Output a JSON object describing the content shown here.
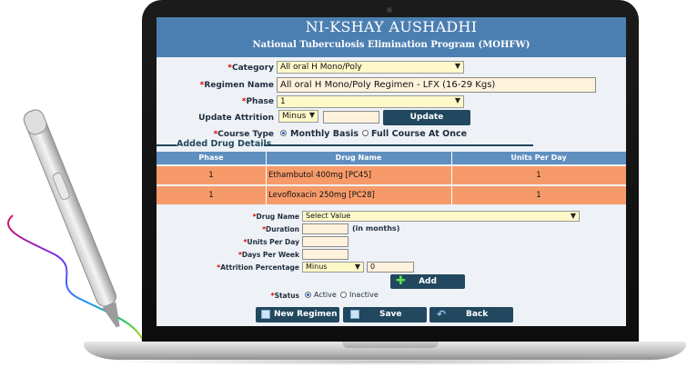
{
  "header": {
    "title": "NI-KSHAY AUSHADHI",
    "subtitle": "National Tuberculosis Elimination Program (MOHFW)"
  },
  "form": {
    "category_label": "Category",
    "category_value": "All oral H Mono/Poly",
    "regimen_name_label": "Regimen Name",
    "regimen_name_value": "All oral H Mono/Poly Regimen - LFX (16-29 Kgs)",
    "phase_label": "Phase",
    "phase_value": "1",
    "update_attrition_label": "Update Attrition",
    "update_attrition_value": "Minus",
    "update_attrition_input": "",
    "update_button": "Update",
    "course_type_label": "Course Type",
    "course_type_options": [
      "Monthly Basis",
      "Full Course At Once"
    ],
    "course_type_selected": "Monthly Basis",
    "required_mark": "*"
  },
  "added_drugs": {
    "section_title": "Added Drug Details",
    "columns": [
      "Phase",
      "Drug Name",
      "Units Per Day"
    ],
    "rows": [
      {
        "phase": "1",
        "drug": "Ethambutol 400mg [PC45]",
        "units": "1"
      },
      {
        "phase": "1",
        "drug": "Levofloxacin 250mg [PC28]",
        "units": "1"
      }
    ]
  },
  "drug_form": {
    "drug_name_label": "Drug Name",
    "drug_name_value": "Select Value",
    "duration_label": "Duration",
    "duration_suffix": "(in months)",
    "units_per_day_label": "Units Per Day",
    "days_per_week_label": "Days Per Week",
    "attrition_label": "Attrition Percentage",
    "attrition_value": "Minus",
    "attrition_input": "0",
    "add_button": "Add",
    "status_label": "Status",
    "status_options": [
      "Active",
      "Inactive"
    ],
    "status_selected": "Active"
  },
  "footer": {
    "new_regimen": "New Regimen",
    "save": "Save",
    "back": "Back"
  },
  "colors": {
    "header_bg": "#4c7fb1",
    "table_head_bg": "#5f8fbf",
    "row_bg": "#f79a6a",
    "button_bg": "#21485e",
    "select_bg": "#fff9c9",
    "input_bg": "#fff2dc"
  }
}
